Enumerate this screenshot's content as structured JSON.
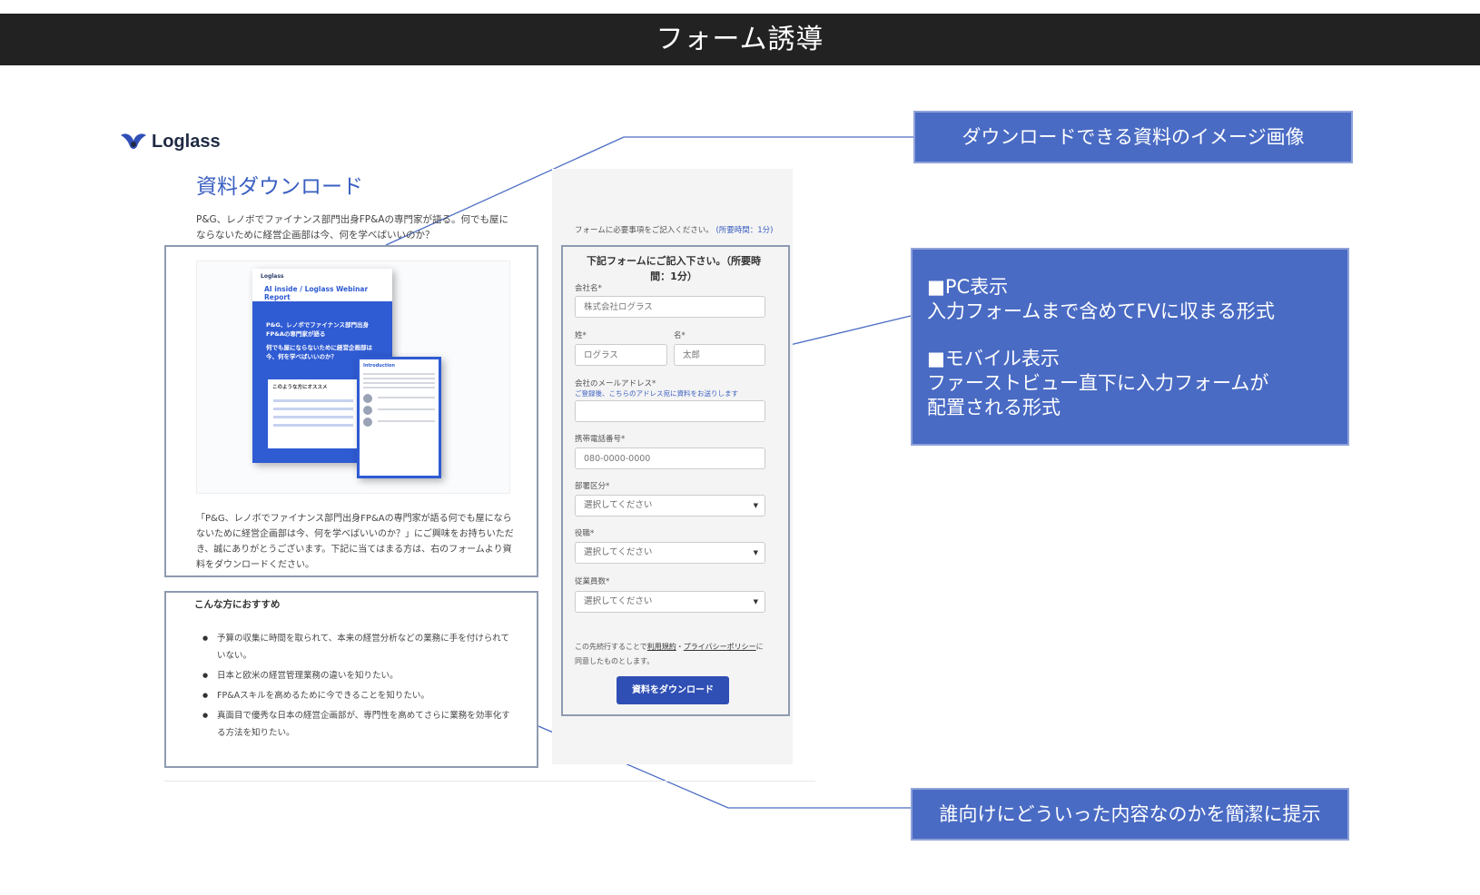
{
  "header": {
    "title": "フォーム誘導"
  },
  "landing": {
    "logo_text": "Loglass",
    "page_title": "資料ダウンロード",
    "lead": "P&G、レノボでファイナンス部門出身FP&Aの専門家が語る。何でも屋にならないために経営企画部は今、何を学べばいいのか？",
    "document_image": {
      "report_logo": "Loglass",
      "report_title": "AI inside / Loglass Webinar Report",
      "report_headline": "P&G、レノボでファイナンス部門出身FP&Aの専門家が語る",
      "report_subheadline": "何でも屋にならないために経営企画部は今、何を学べばいいのか？",
      "report_list_title": "このような方にオススメ",
      "report_inner_title": "Introduction"
    },
    "doc_description": "「P&G、レノボでファイナンス部門出身FP&Aの専門家が語る何でも屋にならないために経営企画部は今、何を学べばいいのか？」にご興味をお持ちいただき、誠にありがとうございます。下記に当てはまる方は、右のフォームより資料をダウンロードください。",
    "recommend": {
      "title": "こんな方におすすめ",
      "items": [
        "予算の収集に時間を取られて、本来の経営分析などの業務に手を付けられていない。",
        "日本と欧米の経営管理業務の違いを知りたい。",
        "FP&Aスキルを高めるために今できることを知りたい。",
        "真面目で優秀な日本の経営企画部が、専門性を高めてさらに業務を効率化する方法を知りたい。"
      ]
    }
  },
  "form": {
    "note": "フォームに必要事項をご記入ください。",
    "note_time": "(所要時間：1分)",
    "heading": "下記フォームにご記入下さい。（所要時間：1分）",
    "company_label": "会社名*",
    "company_placeholder": "株式会社ログラス",
    "last_name_label": "姓*",
    "last_name_placeholder": "ログラス",
    "first_name_label": "名*",
    "first_name_placeholder": "太郎",
    "email_label": "会社のメールアドレス*",
    "email_help": "ご登録後、こちらのアドレス宛に資料をお送りします",
    "email_value": "",
    "phone_label": "携帯電話番号*",
    "phone_placeholder": "080-0000-0000",
    "dept_label": "部署区分*",
    "dept_value": "選択してください",
    "role_label": "役職*",
    "role_value": "選択してください",
    "employees_label": "従業員数*",
    "employees_value": "選択してください",
    "terms_pre": "この先続行することで",
    "terms_link1": "利用規約",
    "terms_sep": "・",
    "terms_link2": "プライバシーポリシー",
    "terms_post": "に同意したものとします。",
    "submit_label": "資料をダウンロード"
  },
  "callouts": {
    "image": "ダウンロードできる資料のイメージ画像",
    "pc_title": "■PC表示",
    "pc_text": "入力フォームまで含めてFVに収まる形式",
    "mobile_title": "■モバイル表示",
    "mobile_text1": "ファーストビュー直下に入力フォームが",
    "mobile_text2": "配置される形式",
    "target": "誰向けにどういった内容なのかを簡潔に提示"
  },
  "colors": {
    "header_bg": "#222222",
    "callout_bg": "#4a6bc4",
    "accent": "#3a5fc1",
    "button": "#2f4fb5"
  }
}
